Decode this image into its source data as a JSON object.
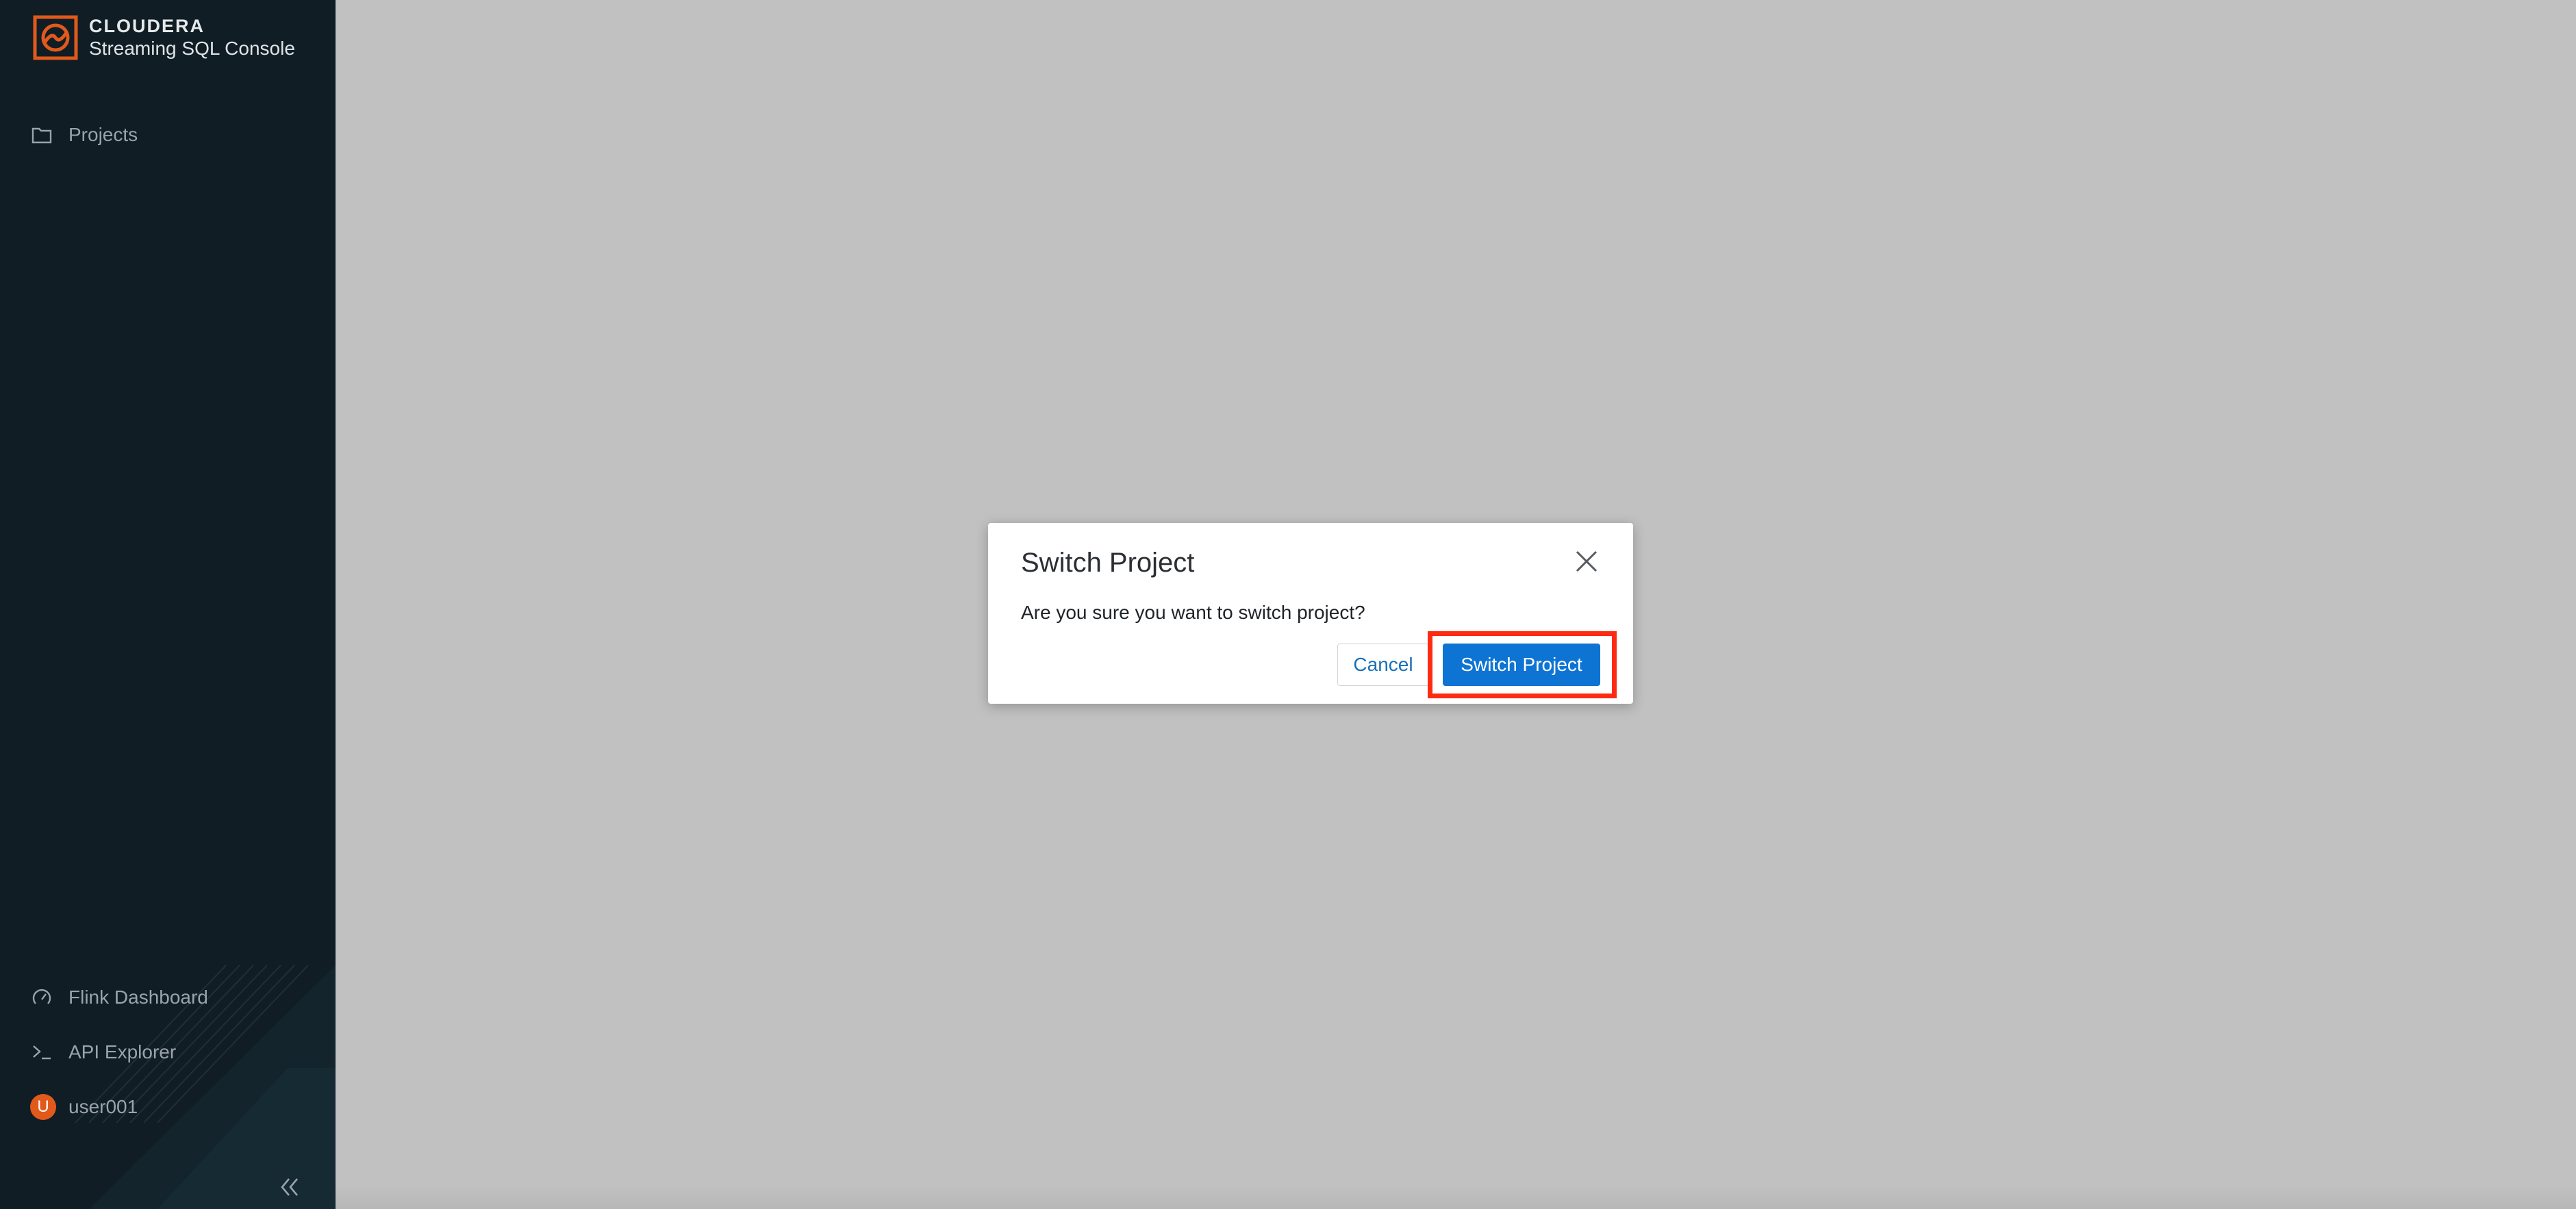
{
  "app": {
    "brand_name": "CLOUDERA",
    "product_name": "Streaming SQL Console",
    "logo_icon": "cloudera-logo-icon",
    "accent_color": "#e15a1c"
  },
  "sidebar": {
    "background": "#101d25",
    "top_items": [
      {
        "label": "Projects",
        "icon": "folder-icon"
      }
    ],
    "bottom_items": [
      {
        "label": "Flink Dashboard",
        "icon": "gauge-icon"
      },
      {
        "label": "API Explorer",
        "icon": "terminal-icon"
      }
    ],
    "user": {
      "name": "user001",
      "initial": "U",
      "avatar_color": "#e15a1c"
    },
    "collapse_icon": "double-chevron-left-icon"
  },
  "dialog": {
    "title": "Switch Project",
    "message": "Are you sure you want to switch project?",
    "cancel_label": "Cancel",
    "confirm_label": "Switch Project",
    "close_icon": "close-icon",
    "confirm_color": "#0e74d3",
    "highlight_color": "#ff2a12"
  },
  "overlay": {
    "backdrop_color": "#c1c1c1"
  }
}
